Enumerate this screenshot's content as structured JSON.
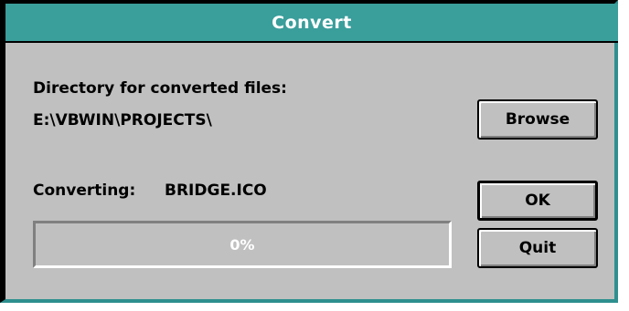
{
  "window": {
    "title": "Convert"
  },
  "directory": {
    "label": "Directory for converted files:",
    "path": "E:\\VBWIN\\PROJECTS\\"
  },
  "converting": {
    "label": "Converting:",
    "filename": "BRIDGE.ICO"
  },
  "progress": {
    "value_percent": 0,
    "text": "0%"
  },
  "buttons": {
    "browse_label": "Browse",
    "ok_label": "OK",
    "quit_label": "Quit"
  },
  "colors": {
    "title_bar": "#3a9e9b",
    "window_face": "#c0c0c0",
    "progress_fill": "#000080"
  }
}
